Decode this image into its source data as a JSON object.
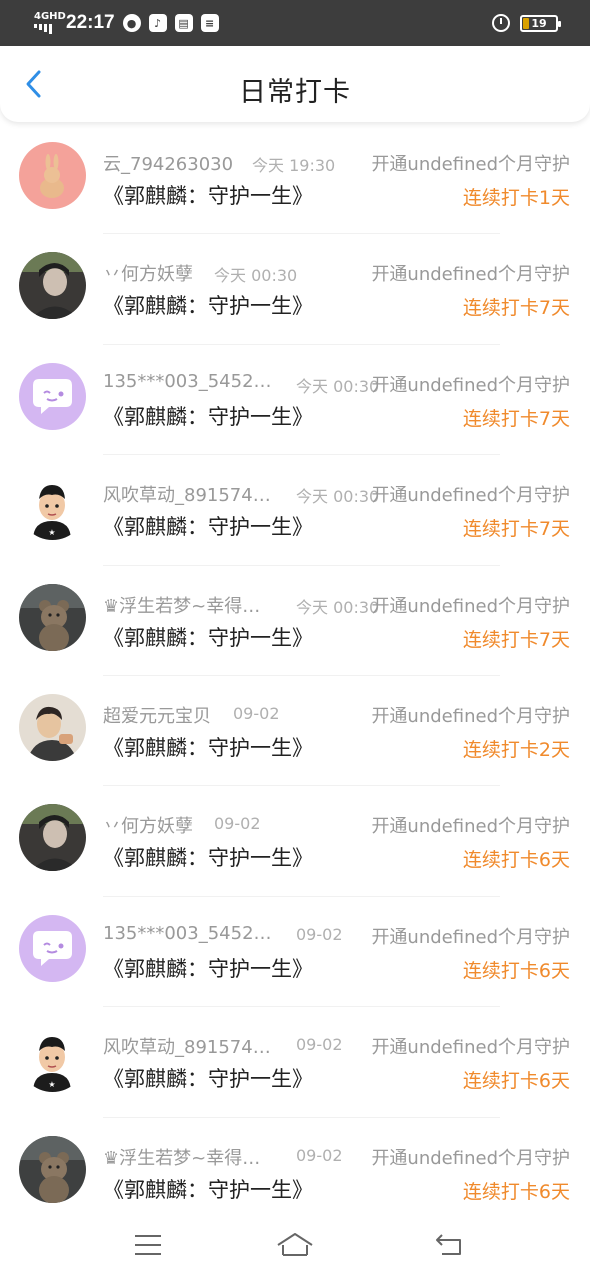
{
  "status_bar": {
    "network": "4GHD",
    "time": "22:17",
    "battery": "19",
    "battery_level": 0.19
  },
  "header": {
    "title": "日常打卡",
    "back_icon": "chevron-left-icon"
  },
  "colors": {
    "accent_back": "#2f8ee6",
    "streak_orange": "#f08a2c",
    "muted_text": "#999999"
  },
  "entries": [
    {
      "name": "云_794263030",
      "time": "今天 19:30",
      "guard": "开通undefined个月守护",
      "title": "《郭麒麟：守护一生》",
      "streak": "连续打卡1天",
      "avatar": "rabbit"
    },
    {
      "name": "丷何方妖孽",
      "time": "今天 00:30",
      "guard": "开通undefined个月守护",
      "title": "《郭麒麟：守护一生》",
      "streak": "连续打卡7天",
      "avatar": "photo-dark"
    },
    {
      "name": "135***003_5452…",
      "time": "今天 00:30",
      "guard": "开通undefined个月守护",
      "title": "《郭麒麟：守护一生》",
      "streak": "连续打卡7天",
      "avatar": "chat"
    },
    {
      "name": "风吹草动_891574…",
      "time": "今天 00:30",
      "guard": "开通undefined个月守护",
      "title": "《郭麒麟：守护一生》",
      "streak": "连续打卡7天",
      "avatar": "cartoon"
    },
    {
      "name": "♛浮生若梦~幸得…",
      "time": "今天 00:30",
      "guard": "开通undefined个月守护",
      "title": "《郭麒麟：守护一生》",
      "streak": "连续打卡7天",
      "avatar": "bear"
    },
    {
      "name": "超爱元元宝贝",
      "time": "09-02",
      "guard": "开通undefined个月守护",
      "title": "《郭麒麟：守护一生》",
      "streak": "连续打卡2天",
      "avatar": "boy"
    },
    {
      "name": "丷何方妖孽",
      "time": "09-02",
      "guard": "开通undefined个月守护",
      "title": "《郭麒麟：守护一生》",
      "streak": "连续打卡6天",
      "avatar": "photo-dark"
    },
    {
      "name": "135***003_5452…",
      "time": "09-02",
      "guard": "开通undefined个月守护",
      "title": "《郭麒麟：守护一生》",
      "streak": "连续打卡6天",
      "avatar": "chat"
    },
    {
      "name": "风吹草动_891574…",
      "time": "09-02",
      "guard": "开通undefined个月守护",
      "title": "《郭麒麟：守护一生》",
      "streak": "连续打卡6天",
      "avatar": "cartoon"
    },
    {
      "name": "♛浮生若梦~幸得…",
      "time": "09-02",
      "guard": "开通undefined个月守护",
      "title": "《郭麒麟：守护一生》",
      "streak": "连续打卡6天",
      "avatar": "bear"
    }
  ],
  "bottom_nav": {
    "items": [
      "menu-icon",
      "home-icon",
      "back-icon"
    ]
  }
}
